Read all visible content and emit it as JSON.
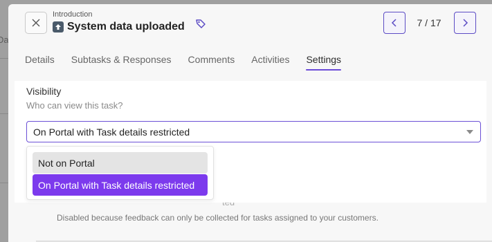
{
  "backdrop": {
    "fragment": "Da"
  },
  "header": {
    "breadcrumb": "Introduction",
    "title": "System data uploaded",
    "pager": "7 / 17",
    "icons": {
      "close": "close-icon",
      "task_type": "upload-icon",
      "tag": "tag-icon",
      "prev": "chevron-left-icon",
      "next": "chevron-right-icon"
    }
  },
  "tabs": [
    {
      "label": "Details",
      "active": false
    },
    {
      "label": "Subtasks & Responses",
      "active": false
    },
    {
      "label": "Comments",
      "active": false
    },
    {
      "label": "Activities",
      "active": false
    },
    {
      "label": "Settings",
      "active": true
    }
  ],
  "visibility": {
    "label": "Visibility",
    "subtitle": "Who can view this task?",
    "selected": "On Portal with Task details restricted",
    "options": [
      {
        "label": "Not on Portal",
        "state": "hover"
      },
      {
        "label": "On Portal with Task details restricted",
        "state": "selected"
      }
    ]
  },
  "feedback": {
    "label_fragment": "ted",
    "disabled_note": "Disabled because feedback can only be collected for tasks assigned to your customers."
  },
  "colors": {
    "accent": "#6b4fd6",
    "selected_option": "#7c3aed",
    "hover_option": "#e4e4e4"
  }
}
